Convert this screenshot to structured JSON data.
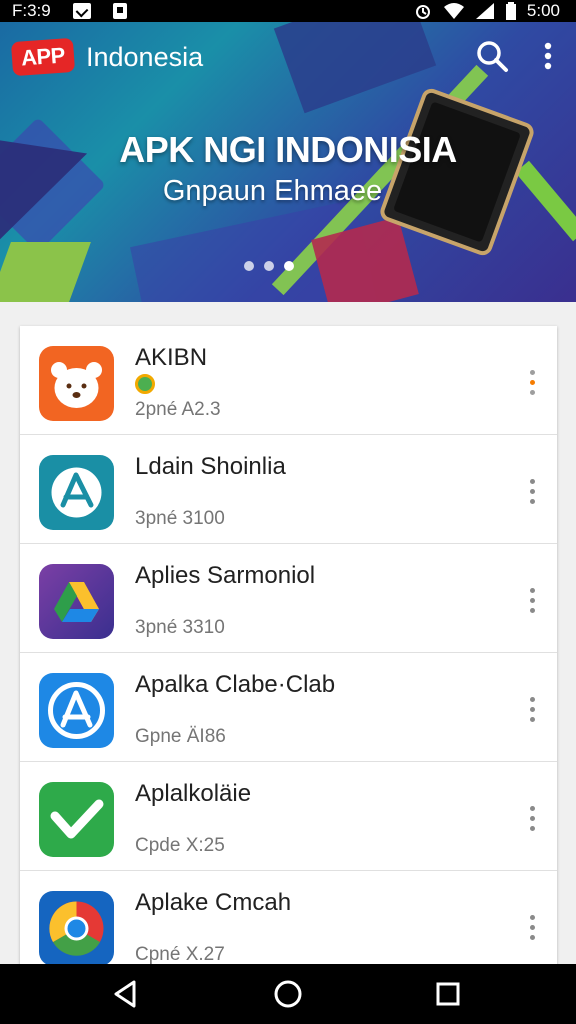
{
  "status_bar": {
    "left_text": "F:3:9",
    "time": "5:00",
    "icons": [
      "notification-icon",
      "notification-icon",
      "alarm-icon",
      "wifi-icon",
      "signal-icon",
      "battery-icon"
    ]
  },
  "header": {
    "logo_text": "APP",
    "title": "Indonesia",
    "search_icon": "search-icon",
    "more_icon": "more-vert-icon"
  },
  "banner": {
    "title": "APK NGI INDONISIA",
    "subtitle": "Gnpaun Ehmaee",
    "dots_count": 3,
    "active_dot": 2
  },
  "apps": [
    {
      "name": "AKIBN",
      "meta": "2pné A2.3",
      "icon": "bear-icon",
      "color": "#f26522",
      "has_badge": true
    },
    {
      "name": "Ldain Shoinlia",
      "meta": "3pné 3100",
      "icon": "app-store-icon",
      "color": "#1a8fa5",
      "has_badge": false
    },
    {
      "name": "Aplies Sarmoniol",
      "meta": "3pné 3310",
      "icon": "drive-icon",
      "color": "#5b3a9b",
      "has_badge": false
    },
    {
      "name": "Apalka Clabe·Clab",
      "meta": "Gpne ÄI86",
      "icon": "app-store-blue-icon",
      "color": "#1e88e5",
      "has_badge": false
    },
    {
      "name": "Aplalkoläie",
      "meta": "Cpde X:25",
      "icon": "checkmark-icon",
      "color": "#2eaa4a",
      "has_badge": false
    },
    {
      "name": "Aplake Cmcah",
      "meta": "Cpné X.27",
      "icon": "chrome-icon",
      "color": "#1565c0",
      "has_badge": false
    }
  ],
  "nav": {
    "back_icon": "back-icon",
    "home_icon": "home-icon",
    "recents_icon": "recents-icon"
  }
}
